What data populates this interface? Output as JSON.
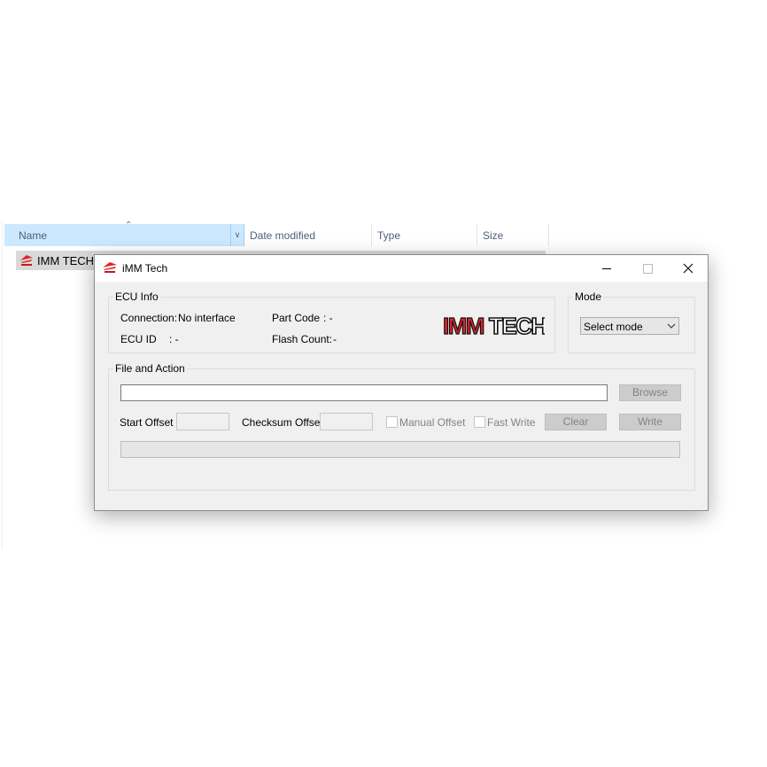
{
  "explorer": {
    "columns": {
      "name": "Name",
      "date": "Date modified",
      "type": "Type",
      "size": "Size"
    },
    "file_name": "IMM TECH.e"
  },
  "window": {
    "title": "iMM Tech",
    "ecu_info": {
      "group_label": "ECU Info",
      "connection_label": "Connection:",
      "connection_value": "No interface",
      "part_code_label": "Part Code",
      "part_code_value": ":  -",
      "ecu_id_label": "ECU ID",
      "ecu_id_value": ":  -",
      "flash_count_label": "Flash Count:",
      "flash_count_value": "-",
      "logo_text": "IMMTECH"
    },
    "mode": {
      "group_label": "Mode",
      "selected": "Select mode"
    },
    "file_action": {
      "group_label": "File and Action",
      "browse_label": "Browse",
      "start_offset_label": "Start Offset",
      "checksum_offset_label": "Checksum Offset",
      "manual_offset_label": "Manual Offset",
      "fast_write_label": "Fast Write",
      "clear_label": "Clear",
      "write_label": "Write"
    }
  },
  "colors": {
    "header_selected": "#cce8ff",
    "logo_red": "#e0242b",
    "disabled_text": "#838383"
  }
}
